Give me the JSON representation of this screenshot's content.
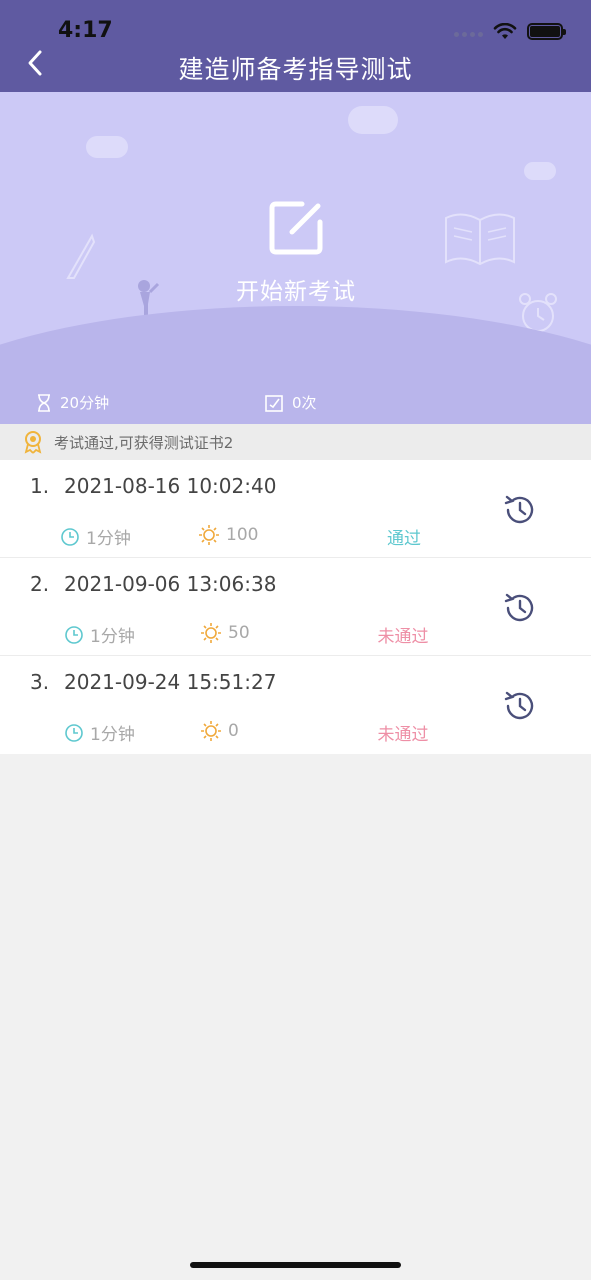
{
  "status_bar": {
    "time": "4:17"
  },
  "nav": {
    "title": "建造师备考指导测试"
  },
  "banner": {
    "start_label": "开始新考试",
    "duration": "20分钟",
    "attempts": "0次"
  },
  "notice": {
    "text": "考试通过,可获得测试证书2"
  },
  "records": [
    {
      "index": "1.",
      "datetime": "2021-08-16 10:02:40",
      "duration": "1分钟",
      "score": "100",
      "status": "通过"
    },
    {
      "index": "2.",
      "datetime": "2021-09-06 13:06:38",
      "duration": "1分钟",
      "score": "50",
      "status": "未通过"
    },
    {
      "index": "3.",
      "datetime": "2021-09-24 15:51:27",
      "duration": "1分钟",
      "score": "0",
      "status": "未通过"
    }
  ],
  "colors": {
    "nav_bg": "#5f5aa1",
    "banner_bg": "#ccc9f6",
    "pass": "#5ec8cf",
    "fail": "#ee8fa6",
    "clock_icon": "#5ec8cf",
    "sun_icon": "#f0a93c",
    "history_icon": "#4a4f7a"
  },
  "icons": [
    "back-chevron-icon",
    "wifi-icon",
    "battery-icon",
    "edit-icon",
    "hourglass-icon",
    "checklist-icon",
    "medal-icon",
    "clock-icon",
    "sun-icon",
    "history-icon"
  ]
}
